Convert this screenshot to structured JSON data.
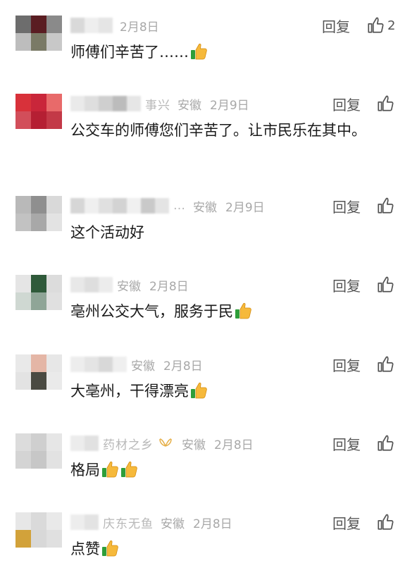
{
  "comments": [
    {
      "name_fragment": "",
      "region": "",
      "date": "2月8日",
      "reply": "回复",
      "likes": "2",
      "text": "师傅们辛苦了……",
      "thumbs": 1,
      "avatar_colors": [
        "#6d6d6d",
        "#5a1d22",
        "#8a8a8a",
        "#bdbdbd",
        "#7a7a66",
        "#c8c8c8"
      ],
      "mosaic": [
        "#d9d9d9",
        "#eeeeee",
        "#e5e5e5"
      ]
    },
    {
      "name_fragment": "事兴",
      "region": "安徽",
      "date": "2月9日",
      "reply": "回复",
      "likes": "",
      "text": "公交车的师傅您们辛苦了。让市民乐在其中。",
      "thumbs": 0,
      "avatar_colors": [
        "#d8313a",
        "#c9263a",
        "#e86a6a",
        "#d24e5a",
        "#b51f33",
        "#c33947"
      ],
      "mosaic": [
        "#eaeaea",
        "#dedede",
        "#cfcfcf",
        "#bcbcbc",
        "#e6e6e6"
      ]
    },
    {
      "name_fragment": "…",
      "region": "安徽",
      "date": "2月9日",
      "reply": "回复",
      "likes": "",
      "text": "这个活动好",
      "thumbs": 0,
      "avatar_colors": [
        "#b9b9b9",
        "#8f8f8f",
        "#d9d9d9",
        "#c2c2c2",
        "#a8a8a8",
        "#e3e3e3"
      ],
      "mosaic": [
        "#d6d6d6",
        "#efefef",
        "#e0e0e0",
        "#d3d3d3",
        "#f0f0f0",
        "#c9c9c9",
        "#e4e4e4"
      ]
    },
    {
      "name_fragment": "",
      "region": "安徽",
      "date": "2月8日",
      "reply": "回复",
      "likes": "",
      "text": "亳州公交大气，服务于民",
      "thumbs": 1,
      "avatar_colors": [
        "#e5e5e5",
        "#2f5a3a",
        "#dcdcdc",
        "#cfd8d2",
        "#8fa597",
        "#e0e0e0"
      ],
      "mosaic": [
        "#e8e8e8",
        "#dedede",
        "#ececec"
      ]
    },
    {
      "name_fragment": "",
      "region": "安徽",
      "date": "2月8日",
      "reply": "回复",
      "likes": "",
      "text": "大亳州，干得漂亮",
      "thumbs": 1,
      "avatar_colors": [
        "#e9e9e9",
        "#e4b6a6",
        "#e7e7e7",
        "#e3e3e3",
        "#4a4a42",
        "#eaeaea"
      ],
      "mosaic": [
        "#ededed",
        "#e4e4e4",
        "#d8d8d8",
        "#efefef"
      ]
    },
    {
      "name_fragment": "药材之乡",
      "region": "安徽",
      "date": "2月8日",
      "reply": "回复",
      "likes": "",
      "text": "格局",
      "thumbs": 2,
      "avatar_colors": [
        "#dcdcdc",
        "#cfcfcf",
        "#e6e6e6",
        "#d4d4d4",
        "#c7c7c7",
        "#e2e2e2"
      ],
      "mosaic": [
        "#ececec",
        "#e1e1e1"
      ]
    },
    {
      "name_fragment": "庆东无鱼",
      "region": "安徽",
      "date": "2月8日",
      "reply": "回复",
      "likes": "",
      "text": "点赞",
      "thumbs": 1,
      "avatar_colors": [
        "#e7e7e7",
        "#dadada",
        "#e9e9e9",
        "#d2a23a",
        "#d8d8d8",
        "#e0e0e0"
      ],
      "mosaic": [
        "#ededed",
        "#e3e3e3"
      ]
    }
  ]
}
